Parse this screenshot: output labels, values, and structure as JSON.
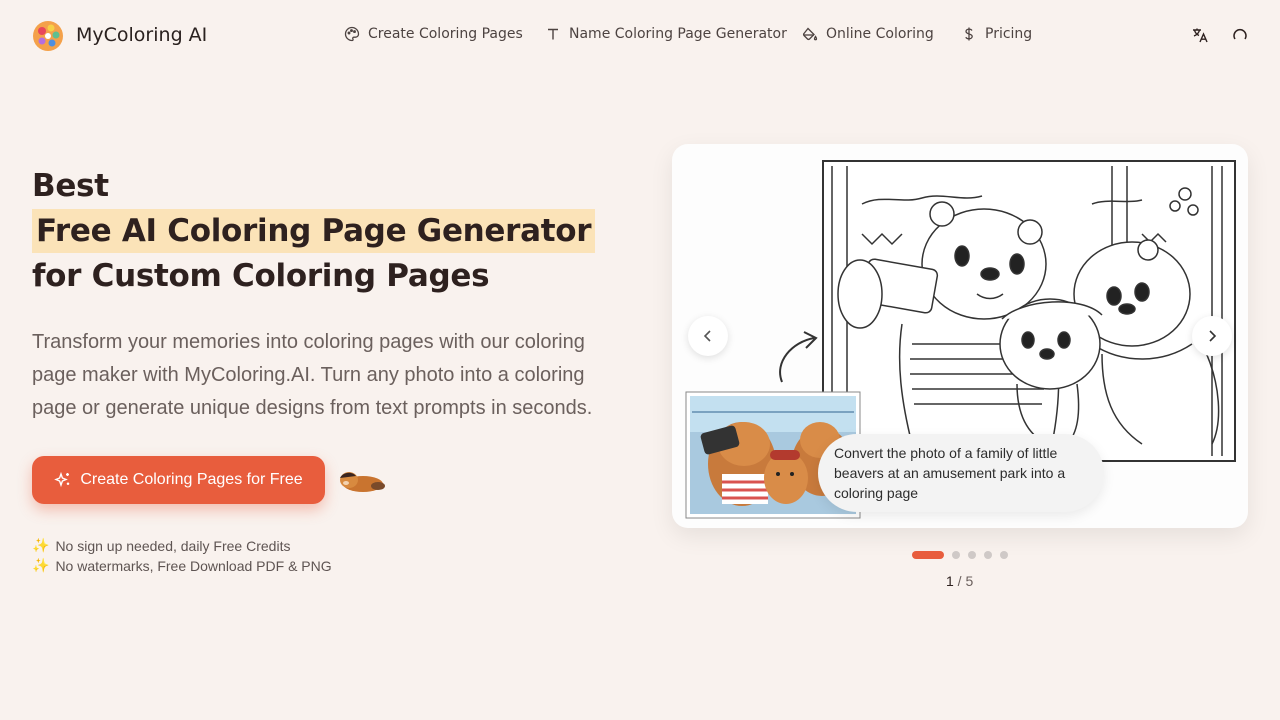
{
  "header": {
    "brand": "MyColoring AI",
    "nav": [
      {
        "label": "Create Coloring Pages",
        "icon": "palette-icon"
      },
      {
        "label": "Name Coloring Page Generator",
        "icon": "text-icon"
      },
      {
        "label": "Online Coloring",
        "icon": "paint-bucket-icon"
      },
      {
        "label": "Pricing",
        "icon": "dollar-icon"
      }
    ],
    "actions": [
      {
        "icon": "language-icon"
      },
      {
        "icon": "loading-icon"
      }
    ]
  },
  "hero": {
    "line1": "Best",
    "line2": "Free AI Coloring Page Generator",
    "line3": "for Custom Coloring Pages",
    "description": "Transform your memories into coloring pages with our coloring page maker with MyColoring.AI. Turn any photo into a coloring page or generate unique designs from text prompts in seconds.",
    "cta_label": "Create Coloring Pages for Free",
    "features": [
      "No sign up needed, daily Free Credits",
      "No watermarks, Free Download PDF & PNG"
    ]
  },
  "carousel": {
    "caption": "Convert the photo of a family of little beavers at an amusement park into a coloring page",
    "current": "1",
    "total": "5",
    "slide_count": 5,
    "active_index": 0
  },
  "colors": {
    "accent": "#e85d3d",
    "highlight": "#fbe3b8",
    "background": "#f9f2ee"
  }
}
